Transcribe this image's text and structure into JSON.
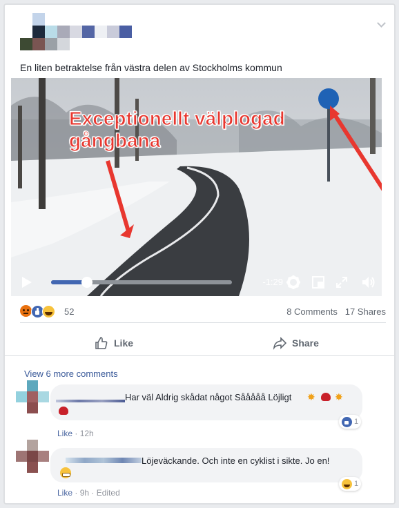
{
  "post": {
    "caption": "En liten betraktelse från västra delen av Stockholms kommun"
  },
  "video": {
    "overlay_line1": "Exceptionellt välplogad",
    "overlay_line2": "gångbana",
    "time_remaining": "-1:29",
    "progress": 0.2
  },
  "stats": {
    "reactions_count": "52",
    "comments": "8 Comments",
    "shares": "17 Shares",
    "reactions": [
      "angry-icon",
      "like-icon",
      "haha-icon"
    ]
  },
  "actions": {
    "like_label": "Like",
    "share_label": "Share"
  },
  "comments_section": {
    "view_more": "View 6 more comments",
    "items": [
      {
        "text": "Har väl Aldrig skådat något Sååååå Löjligt",
        "like_label": "Like",
        "time": "12h",
        "edited": "",
        "reaction_count": "1",
        "reaction_icon": "like-icon"
      },
      {
        "text": "Löjeväckande. Och inte en cyklist i sikte. Jo en!",
        "like_label": "Like",
        "time": "9h",
        "edited": "Edited",
        "reaction_count": "1",
        "reaction_icon": "haha-icon"
      }
    ]
  }
}
